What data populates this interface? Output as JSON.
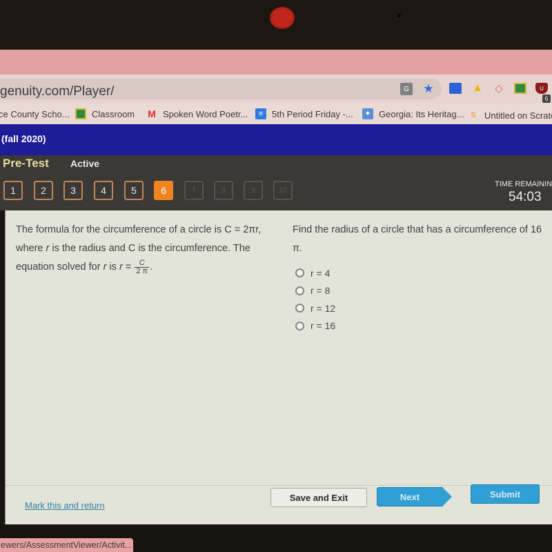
{
  "browser": {
    "url": "genuity.com/Player/",
    "extensions": [
      {
        "name": "calendar-extension-icon"
      },
      {
        "name": "google-drive-icon"
      },
      {
        "name": "cast-extension-icon"
      },
      {
        "name": "google-classroom-icon"
      },
      {
        "name": "ublock-shield-icon",
        "badge": "6"
      }
    ],
    "bookmarks": [
      {
        "label": "ce County Scho...",
        "icon": "school-icon"
      },
      {
        "label": "Classroom",
        "icon": "classroom-icon"
      },
      {
        "label": "Spoken Word Poetr...",
        "icon": "gmail-icon"
      },
      {
        "label": "5th Period Friday -...",
        "icon": "docs-icon"
      },
      {
        "label": "Georgia: Its Heritag...",
        "icon": "georgia-icon"
      },
      {
        "label": "Untitled on Scratch",
        "icon": "scratch-icon"
      }
    ],
    "status_url": "ewers/AssessmentViewer/Activit..."
  },
  "course": {
    "title": "(fall 2020)"
  },
  "test": {
    "name": "Pre-Test",
    "status": "Active",
    "questions": [
      {
        "label": "1",
        "state": "answered"
      },
      {
        "label": "2",
        "state": "answered"
      },
      {
        "label": "3",
        "state": "answered"
      },
      {
        "label": "4",
        "state": "answered"
      },
      {
        "label": "5",
        "state": "answered"
      },
      {
        "label": "6",
        "state": "current"
      },
      {
        "label": "7",
        "state": "locked"
      },
      {
        "label": "8",
        "state": "locked"
      },
      {
        "label": "9",
        "state": "locked"
      },
      {
        "label": "10",
        "state": "locked"
      }
    ],
    "time_label": "TIME REMAINING",
    "time_value": "54:03"
  },
  "question": {
    "context_line1_a": "The formula for the circumference of a circle is ",
    "context_line1_b": "C = 2πr,",
    "context_line2_a": "where ",
    "context_line2_r": "r",
    "context_line2_b": " is the radius and C is the circumference. The",
    "context_line3_a": "equation solved for ",
    "context_line3_r": "r",
    "context_line3_b": " is ",
    "context_line3_r2": "r",
    "context_line3_eq": " = ",
    "fraction_num": "C",
    "fraction_den": "2 π",
    "context_end": ".",
    "prompt_line1": "Find the radius of a circle that has a circumference of 16",
    "prompt_line2": "π.",
    "options": [
      {
        "label": "r = 4"
      },
      {
        "label": "r = 8"
      },
      {
        "label": "r = 12"
      },
      {
        "label": "r = 16"
      }
    ]
  },
  "footer": {
    "mark_link": "Mark this and return",
    "save_label": "Save and Exit",
    "next_label": "Next",
    "submit_label": "Submit"
  }
}
